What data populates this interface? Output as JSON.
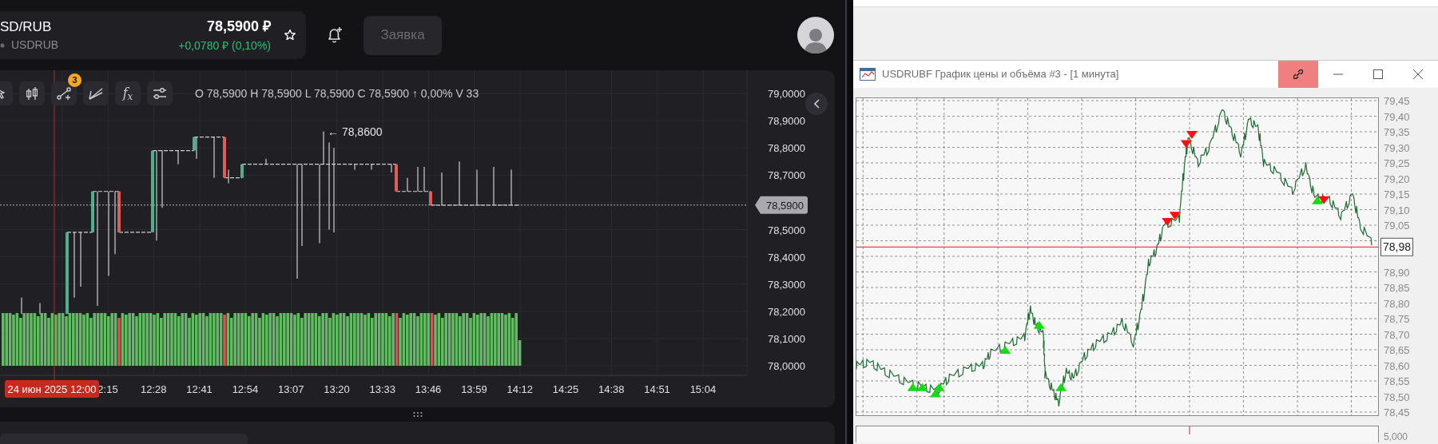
{
  "instrument": {
    "ticker": "SD/RUB",
    "code": "USDRUB",
    "price": "78,5900 ₽",
    "change": "+0,0780 ₽ (0,10%)",
    "favorite": false
  },
  "order_button": "Заявка",
  "chart": {
    "drawings_badge": "3",
    "indicators_label": "f$_{x}$",
    "ohlc": "O 78,5900 H 78,5900 L 78,5900 C 78,5900 ↑ 0,00% V 33",
    "price_axis": [
      "79,0000",
      "78,9000",
      "78,8000",
      "78,7000",
      "78,5000",
      "78,4000",
      "78,3000",
      "78,2000",
      "78,1000",
      "78,0000"
    ],
    "current_price": "78,5900",
    "high_marker": "← 78,8600",
    "time_axis": [
      "2:15",
      "12:28",
      "12:41",
      "12:54",
      "13:07",
      "13:20",
      "13:33",
      "13:46",
      "13:59",
      "14:12",
      "14:25",
      "14:38",
      "14:51",
      "15:04"
    ],
    "crosshair_time": "24 июн 2025 12:00"
  },
  "terminal_window": {
    "title": "USDRUBF График цены и объёма #3 - [1 минута]",
    "link_active": true,
    "price_axis": [
      "79,45",
      "79,40",
      "79,35",
      "79,30",
      "79,25",
      "79,20",
      "79,15",
      "79,10",
      "79,05",
      "78,90",
      "78,85",
      "78,80",
      "78,75",
      "78,70",
      "78,65",
      "78,60",
      "78,55",
      "78,50",
      "78,45"
    ],
    "last_price": "78,98",
    "lower_axis_label": "5,000"
  }
}
